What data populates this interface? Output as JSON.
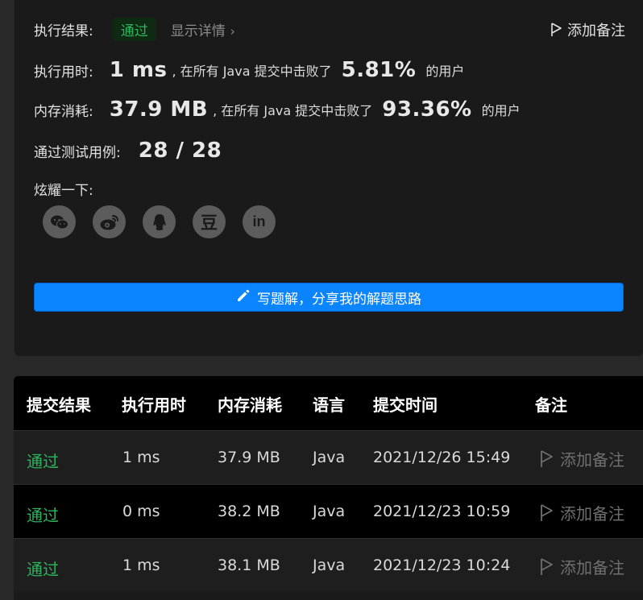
{
  "summary": {
    "result_label": "执行结果:",
    "result_value": "通过",
    "details_link": "显示详情",
    "details_chevron": "›",
    "add_note": "添加备注",
    "runtime_label": "执行用时:",
    "runtime_value": "1 ms",
    "runtime_mid": ", 在所有 Java 提交中击败了",
    "runtime_percent": "5.81%",
    "runtime_suffix": "的用户",
    "memory_label": "内存消耗:",
    "memory_value": "37.9 MB",
    "memory_mid": ", 在所有 Java 提交中击败了",
    "memory_percent": "93.36%",
    "memory_suffix": "的用户",
    "tests_label": "通过测试用例:",
    "tests_value": "28 / 28",
    "share_label": "炫耀一下:",
    "share_icons": [
      "wechat-icon",
      "weibo-icon",
      "qq-icon",
      "douban-icon",
      "linkedin-icon"
    ],
    "douban_glyph": "豆",
    "linkedin_glyph": "in",
    "write_solution": "写题解，分享我的解题思路"
  },
  "table": {
    "headers": [
      "提交结果",
      "执行用时",
      "内存消耗",
      "语言",
      "提交时间",
      "备注"
    ],
    "rows": [
      {
        "status": "通过",
        "runtime": "1 ms",
        "memory": "37.9 MB",
        "language": "Java",
        "time": "2021/12/26 15:49",
        "note": "添加备注"
      },
      {
        "status": "通过",
        "runtime": "0 ms",
        "memory": "38.2 MB",
        "language": "Java",
        "time": "2021/12/23 10:59",
        "note": "添加备注"
      },
      {
        "status": "通过",
        "runtime": "1 ms",
        "memory": "38.1 MB",
        "language": "Java",
        "time": "2021/12/23 10:24",
        "note": "添加备注"
      }
    ]
  },
  "colors": {
    "accent": "#0a84ff",
    "success": "#2db55d",
    "panel_bg": "#1a1a1a",
    "header_bg": "#000000"
  }
}
